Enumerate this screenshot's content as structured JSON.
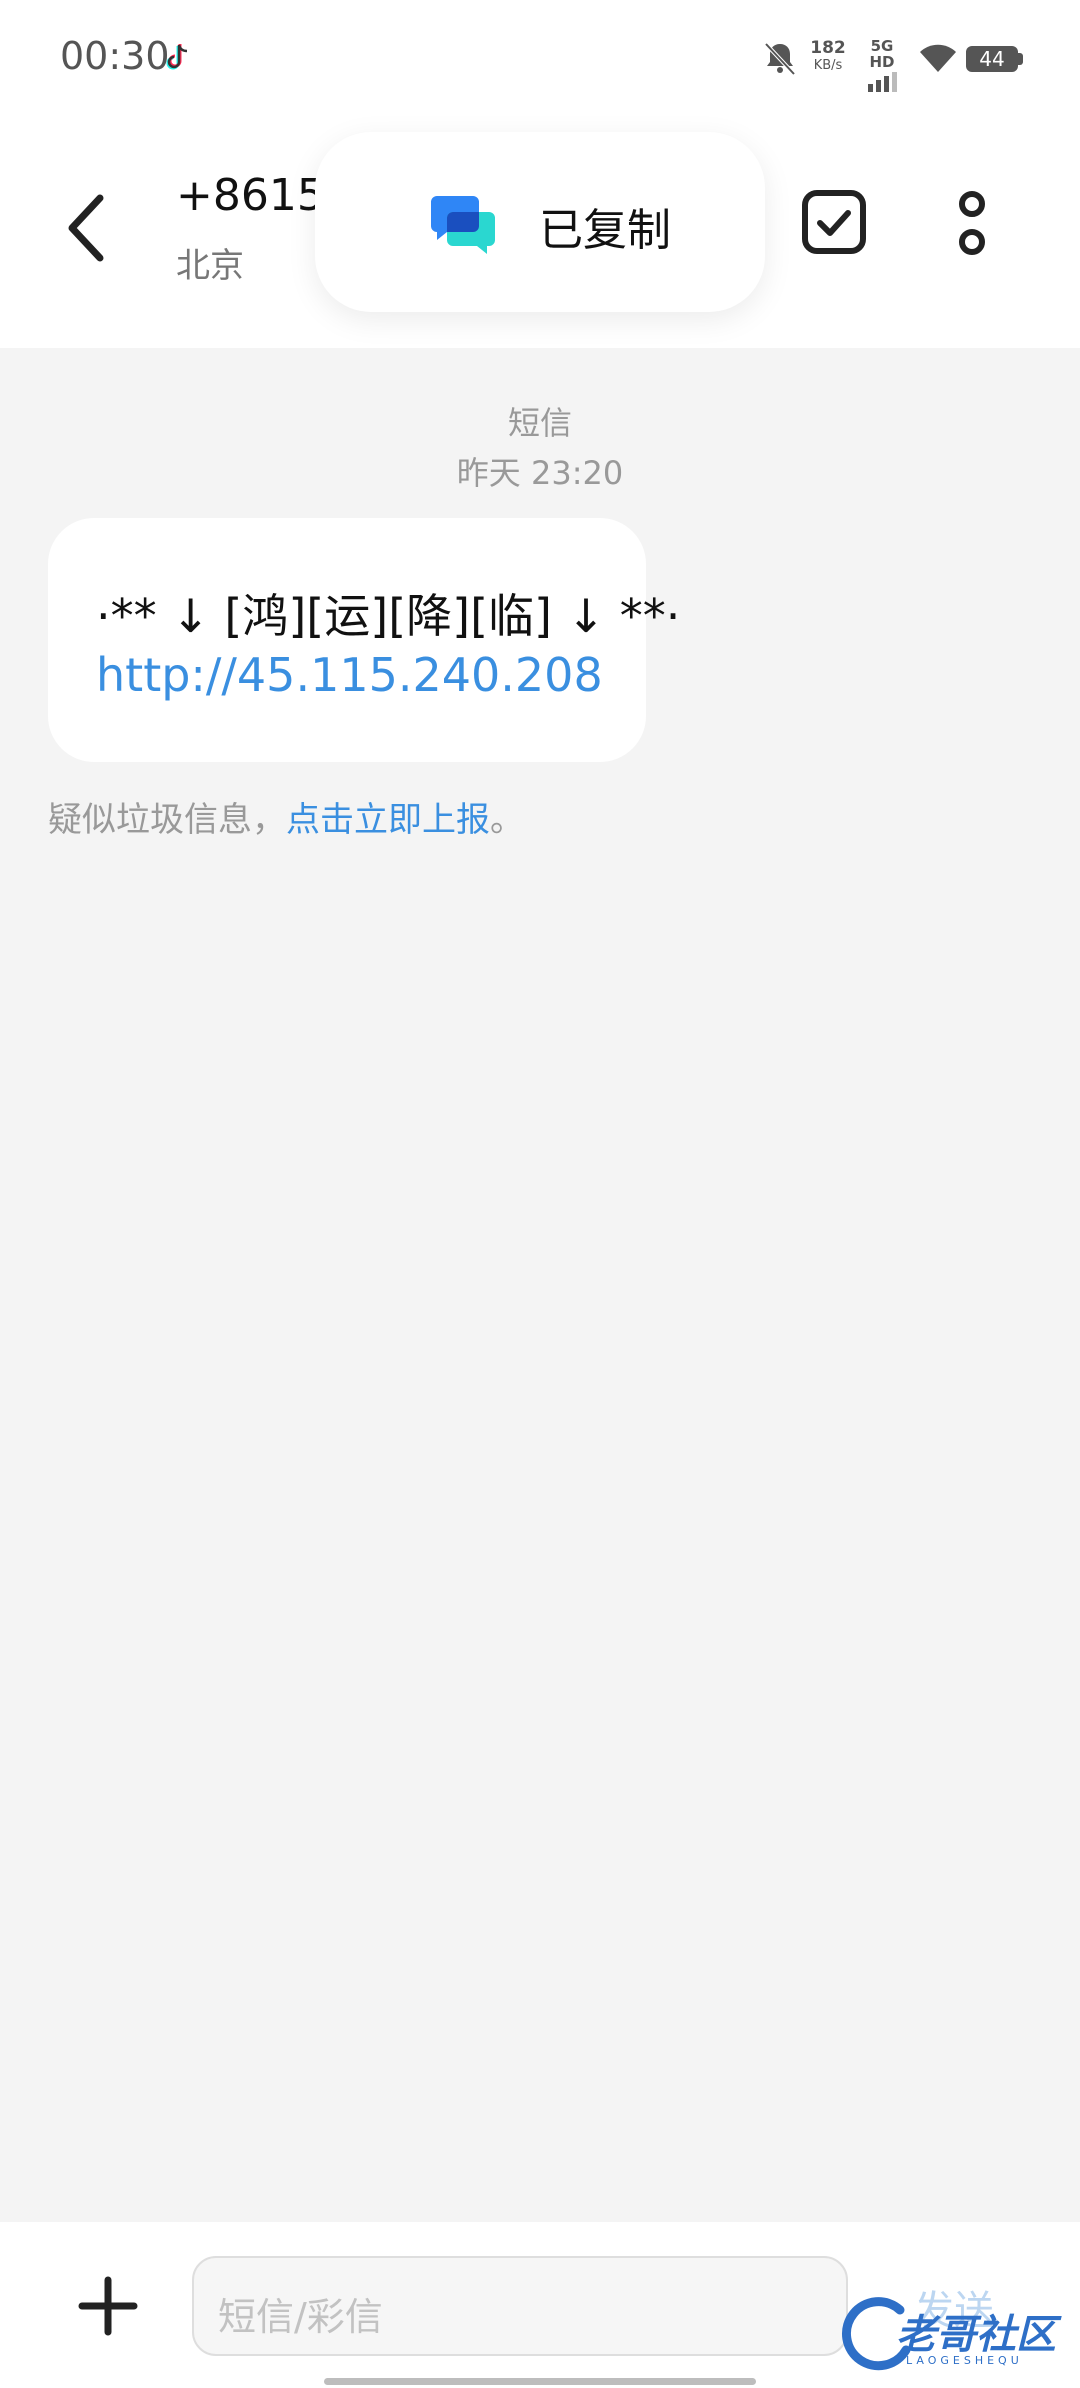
{
  "status_bar": {
    "time": "00:30",
    "net_speed_value": "182",
    "net_speed_unit": "KB/s",
    "network": "5G HD",
    "battery": "44"
  },
  "header": {
    "phone_number": "+8615",
    "location": "北京"
  },
  "toast": {
    "text": "已复制"
  },
  "conversation": {
    "message_type": "短信",
    "timestamp": "昨天 23:20",
    "message": {
      "line1": "·** ↓ [鸿][运][降][临] ↓ **·",
      "link": "http://45.115.240.208"
    },
    "spam_notice": {
      "prefix": "疑似垃圾信息，",
      "link": "点击立即上报",
      "suffix": "。"
    }
  },
  "composer": {
    "placeholder": "短信/彩信",
    "send_label": "发送"
  },
  "watermark": {
    "text": "老哥社区",
    "sub": "LAOGESHEQU"
  },
  "colors": {
    "link": "#3a8fe0",
    "background": "#f4f4f4",
    "bubble": "#ffffff"
  }
}
